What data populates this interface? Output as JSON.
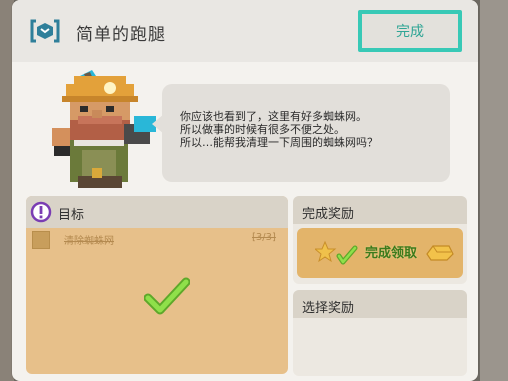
{
  "header": {
    "title": "简单的跑腿",
    "finish_label": "完成"
  },
  "npc": {
    "dialog_lines": [
      "你应该也看到了，这里有好多蜘蛛网。",
      "所以做事的时候有很多不便之处。",
      "所以…能帮我清理一下周围的蜘蛛网吗？"
    ]
  },
  "goal": {
    "title": "目标",
    "task_name": "清除蜘蛛网",
    "task_progress": "[3/3]",
    "completed": true
  },
  "reward": {
    "title": "完成奖励",
    "claim_label": "完成领取"
  },
  "select_reward": {
    "title": "选择奖励"
  },
  "colors": {
    "accent": "#38c9b6",
    "goal_bg": "#e7c08a",
    "check_green": "#7bd13b",
    "goal_icon": "#7a3db3"
  }
}
